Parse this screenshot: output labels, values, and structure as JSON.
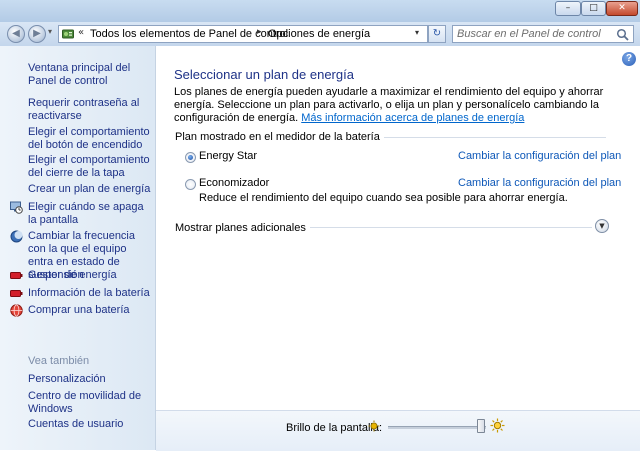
{
  "window": {
    "minimize_glyph": "–",
    "maximize_glyph": "□",
    "close_glyph": "✕"
  },
  "navigation": {
    "back_glyph": "◀",
    "forward_glyph": "▶",
    "history_glyph": "▾",
    "address": {
      "icon": "control-panel-icon",
      "overflow_glyph": "«",
      "crumbs": [
        "Todos los elementos de Panel de control",
        "Opciones de energía"
      ],
      "separator_glyph": "▸",
      "dropdown_glyph": "▾"
    },
    "refresh_glyph": "↻",
    "search": {
      "placeholder": "Buscar en el Panel de control",
      "value": "",
      "icon": "search-icon"
    }
  },
  "sidebar": {
    "home_link": "Ventana principal del Panel de control",
    "tasks": [
      {
        "label": "Requerir contraseña al reactivarse",
        "icon": null
      },
      {
        "label": "Elegir el comportamiento del botón de encendido",
        "icon": null
      },
      {
        "label": "Elegir el comportamiento del cierre de la tapa",
        "icon": null
      },
      {
        "label": "Crear un plan de energía",
        "icon": null
      },
      {
        "label": "Elegir cuándo se apaga la pantalla",
        "icon": "display-clock-icon"
      },
      {
        "label": "Cambiar la frecuencia con la que el equipo entra en estado de suspensión",
        "icon": "moon-icon"
      },
      {
        "label": "Gestor de energía",
        "icon": "battery-red-icon"
      },
      {
        "label": "Información de la batería",
        "icon": "battery-red-icon"
      },
      {
        "label": "Comprar una batería",
        "icon": "globe-icon"
      }
    ],
    "see_also_heading": "Vea también",
    "see_also": [
      "Personalización",
      "Centro de movilidad de Windows",
      "Cuentas de usuario"
    ]
  },
  "main": {
    "help_glyph": "?",
    "title": "Seleccionar un plan de energía",
    "description": "Los planes de energía pueden ayudarle a maximizar el rendimiento del equipo y ahorrar energía. Seleccione un plan para activarlo, o elija un plan y personalícelo cambiando la configuración de energía.",
    "more_info_link": "Más información acerca de planes de energía",
    "plans_header": "Plan mostrado en el medidor de la batería",
    "plans": [
      {
        "name": "Energy Star",
        "selected": true,
        "link": "Cambiar la configuración del plan",
        "description": ""
      },
      {
        "name": "Economizador",
        "selected": false,
        "link": "Cambiar la configuración del plan",
        "description": "Reduce el rendimiento del equipo cuando sea posible para ahorrar energía."
      }
    ],
    "additional_plans": "Mostrar planes adicionales",
    "expand_glyph": "▼"
  },
  "brightness": {
    "label": "Brillo de la pantalla:",
    "level_percent": 95,
    "accent": "#e8b400"
  },
  "colors": {
    "link": "#1e3287",
    "sidebar_bg": "#e4edf7",
    "close_button": "#c44a2d"
  }
}
